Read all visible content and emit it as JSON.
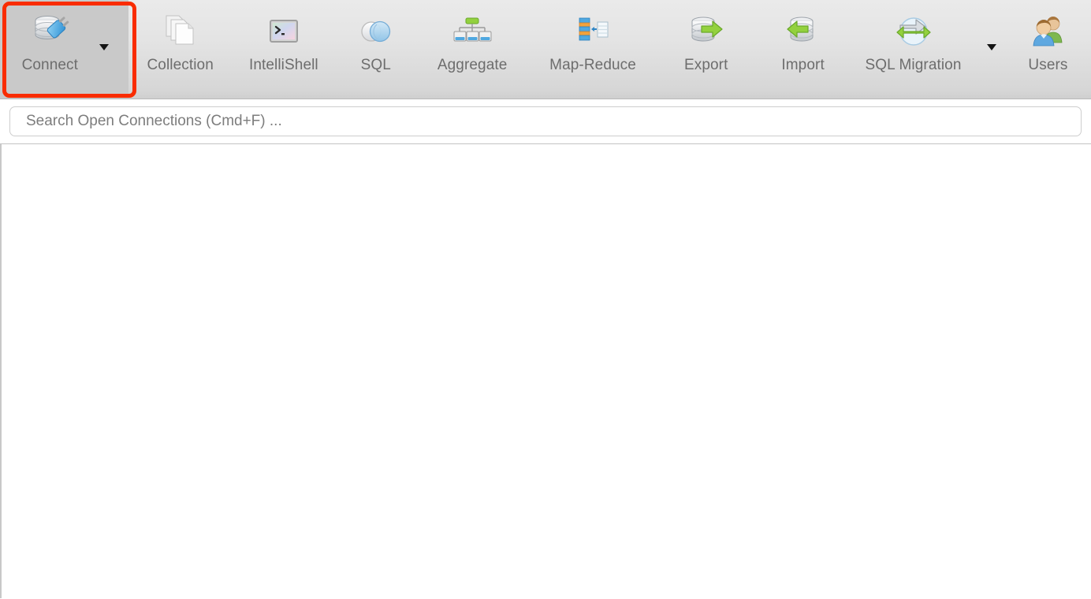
{
  "app": {
    "title": "NoSQLBooster",
    "accent_highlight_color": "#f92c00",
    "toolbar_bg": "#e4e4e4",
    "label_color": "#6d6d6d"
  },
  "toolbar": {
    "items": [
      {
        "id": "connect",
        "label": "Connect",
        "icon": "database-plug-icon",
        "has_caret": true,
        "selected": true,
        "highlighted": true
      },
      {
        "id": "collection",
        "label": "Collection",
        "icon": "documents-stack-icon",
        "has_caret": false,
        "selected": false,
        "highlighted": false
      },
      {
        "id": "intellishell",
        "label": "IntelliShell",
        "icon": "terminal-icon",
        "has_caret": false,
        "selected": false,
        "highlighted": false
      },
      {
        "id": "sql",
        "label": "SQL",
        "icon": "two-circles-icon",
        "has_caret": false,
        "selected": false,
        "highlighted": false
      },
      {
        "id": "aggregate",
        "label": "Aggregate",
        "icon": "aggregate-tree-icon",
        "has_caret": false,
        "selected": false,
        "highlighted": false
      },
      {
        "id": "map-reduce",
        "label": "Map-Reduce",
        "icon": "map-reduce-icon",
        "has_caret": false,
        "selected": false,
        "highlighted": false
      },
      {
        "id": "export",
        "label": "Export",
        "icon": "database-export-arrow-icon",
        "has_caret": false,
        "selected": false,
        "highlighted": false
      },
      {
        "id": "import",
        "label": "Import",
        "icon": "database-import-arrow-icon",
        "has_caret": false,
        "selected": false,
        "highlighted": false
      },
      {
        "id": "sql-migration",
        "label": "SQL Migration",
        "icon": "sync-arrows-icon",
        "has_caret": true,
        "selected": false,
        "highlighted": false
      },
      {
        "id": "users",
        "label": "Users",
        "icon": "users-icon",
        "has_caret": false,
        "selected": false,
        "highlighted": false
      }
    ]
  },
  "search": {
    "placeholder": "Search Open Connections (Cmd+F) ...",
    "value": ""
  },
  "content": {
    "empty": true,
    "text": ""
  }
}
